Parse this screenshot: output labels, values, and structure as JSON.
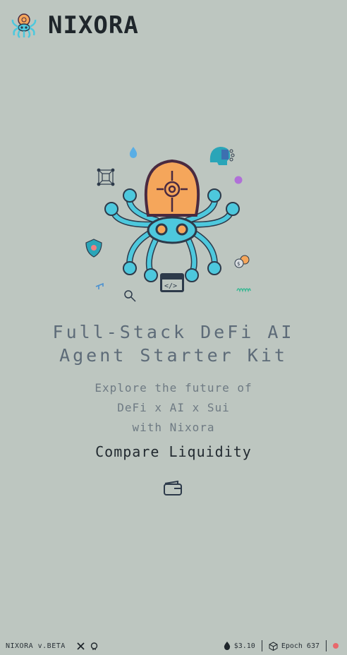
{
  "header": {
    "brand": "NIXORA"
  },
  "hero": {
    "title_line1": "Full-Stack DeFi AI",
    "title_line2": "Agent Starter Kit",
    "subtitle_line1": "Explore the future of",
    "subtitle_line2": "DeFi x AI x Sui",
    "subtitle_line3": "with Nixora"
  },
  "action": {
    "compare_label": "Compare Liquidity"
  },
  "footer": {
    "version": "NIXORA v.BETA",
    "price": "$3.10",
    "epoch": "Epoch 637"
  },
  "colors": {
    "background": "#bdc6c0",
    "octopus_cyan": "#4dc8dd",
    "octopus_orange": "#f5a65b",
    "status_red": "#e8686c"
  },
  "icons": [
    "logo-octopus-icon",
    "octopus-illustration",
    "water-drop-icon",
    "network-cube-icon",
    "ai-head-icon",
    "purple-orb-icon",
    "shield-icon",
    "code-window-icon",
    "coins-icon",
    "zoom-search-icon",
    "wallet-icon",
    "x-twitter-icon",
    "github-icon",
    "sui-drop-icon",
    "cube-icon"
  ]
}
